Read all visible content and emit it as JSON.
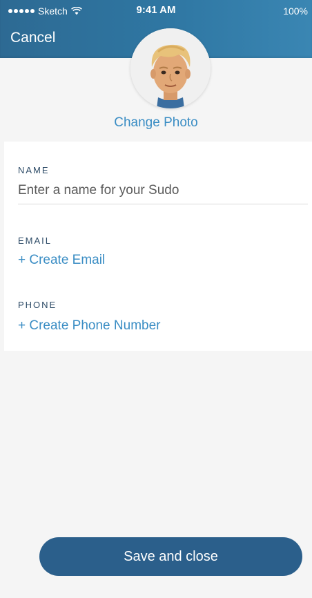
{
  "status_bar": {
    "carrier": "Sketch",
    "time": "9:41 AM",
    "battery": "100%"
  },
  "header": {
    "cancel_label": "Cancel",
    "change_photo_label": "Change Photo"
  },
  "form": {
    "name_label": "NAME",
    "name_placeholder": "Enter a name for your Sudo",
    "name_value": "",
    "email_label": "EMAIL",
    "create_email_label": "+ Create Email",
    "phone_label": "PHONE",
    "create_phone_label": "+ Create Phone Number"
  },
  "footer": {
    "save_label": "Save and close"
  },
  "colors": {
    "header": "#2f77a3",
    "accent_link": "#3a8dc4",
    "primary_button": "#2b5f8b",
    "background": "#f5f5f5"
  }
}
